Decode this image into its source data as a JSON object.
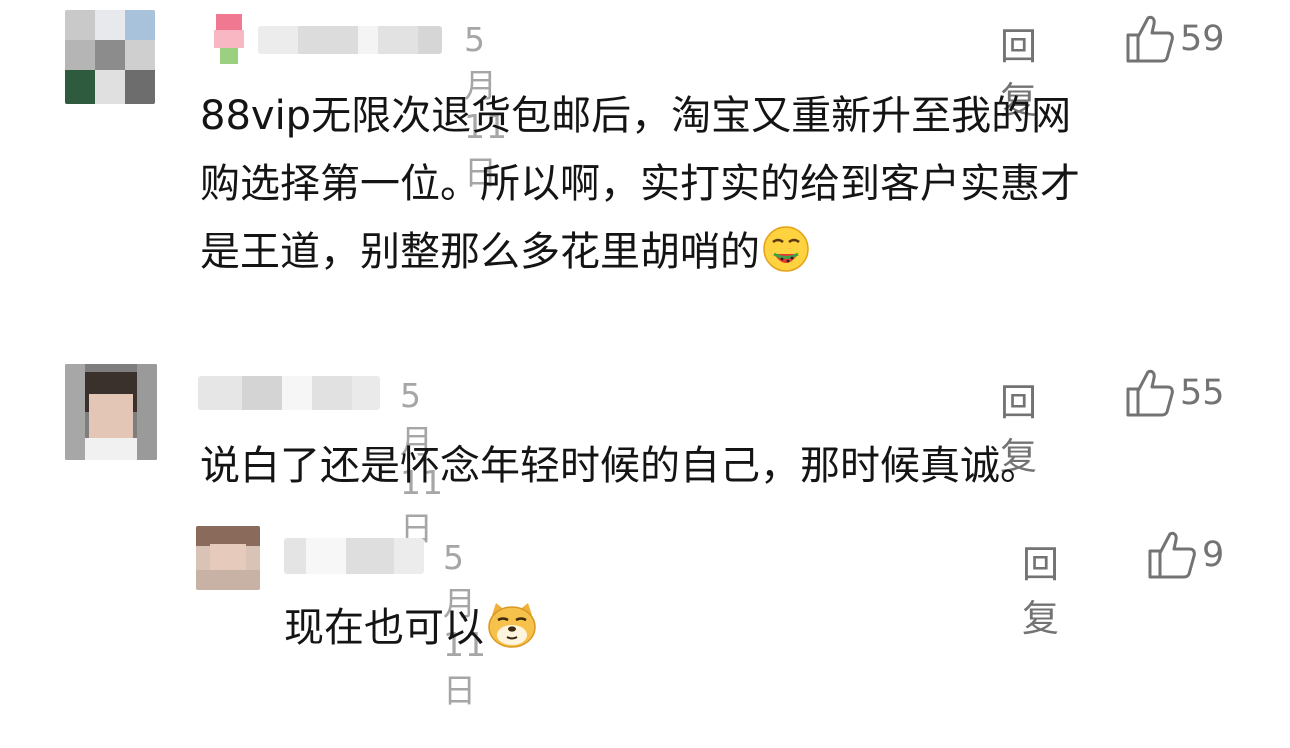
{
  "comments": [
    {
      "date": "5月11日",
      "reply_label": "回复",
      "likes": "59",
      "text_lines": [
        "88vip无限次退货包邮后，淘宝又重新升至我的网",
        "购选择第一位。所以啊，实打实的给到客户实惠才",
        "是王道，别整那么多花里胡哨的"
      ],
      "emoji": "drooling-face-with-watermelon-icon"
    },
    {
      "date": "5月11日",
      "reply_label": "回复",
      "likes": "55",
      "text_lines": [
        "说白了还是怀念年轻时候的自己，那时候真诚。"
      ]
    },
    {
      "date": "5月11日",
      "reply_label": "回复",
      "likes": "9",
      "text_lines": [
        "现在也可以"
      ],
      "emoji": "doge-face-icon"
    }
  ],
  "colors": {
    "date": "#a6a6a6",
    "action": "#737373",
    "text": "#141414"
  }
}
